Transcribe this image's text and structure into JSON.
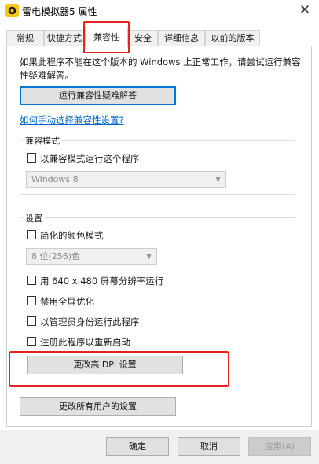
{
  "window": {
    "title": "雷电模拟器5 属性",
    "close_glyph": "✕"
  },
  "tabs": [
    {
      "label": "常规",
      "active": false
    },
    {
      "label": "快捷方式",
      "active": false
    },
    {
      "label": "兼容性",
      "active": true
    },
    {
      "label": "安全",
      "active": false
    },
    {
      "label": "详细信息",
      "active": false
    },
    {
      "label": "以前的版本",
      "active": false
    }
  ],
  "compat": {
    "intro_line1": "如果此程序不能在这个版本的 Windows 上正常工作，请尝试运行兼容",
    "intro_line2": "性疑难解答。",
    "troubleshoot_button": "运行兼容性疑难解答",
    "manual_link": "如何手动选择兼容性设置?",
    "mode_group": {
      "legend": "兼容模式",
      "checkbox_label": "以兼容模式运行这个程序:",
      "checked": false,
      "os_select": "Windows 8"
    },
    "settings_group": {
      "legend": "设置",
      "reduced_color_label": "简化的颜色模式",
      "color_select": "8 位(256)色",
      "res_640_label": "用 640 x 480 屏幕分辨率运行",
      "disable_fullscreen_label": "禁用全屏优化",
      "run_as_admin_label": "以管理员身份运行此程序",
      "register_restart_label": "注册此程序以重新启动",
      "dpi_button": "更改高 DPI 设置"
    },
    "all_users_button": "更改所有用户的设置"
  },
  "footer": {
    "ok": "确定",
    "cancel": "取消",
    "apply": "应用(A)"
  },
  "colors": {
    "highlight": "#e32420",
    "link": "#0066cc",
    "focus": "#0078d7"
  }
}
